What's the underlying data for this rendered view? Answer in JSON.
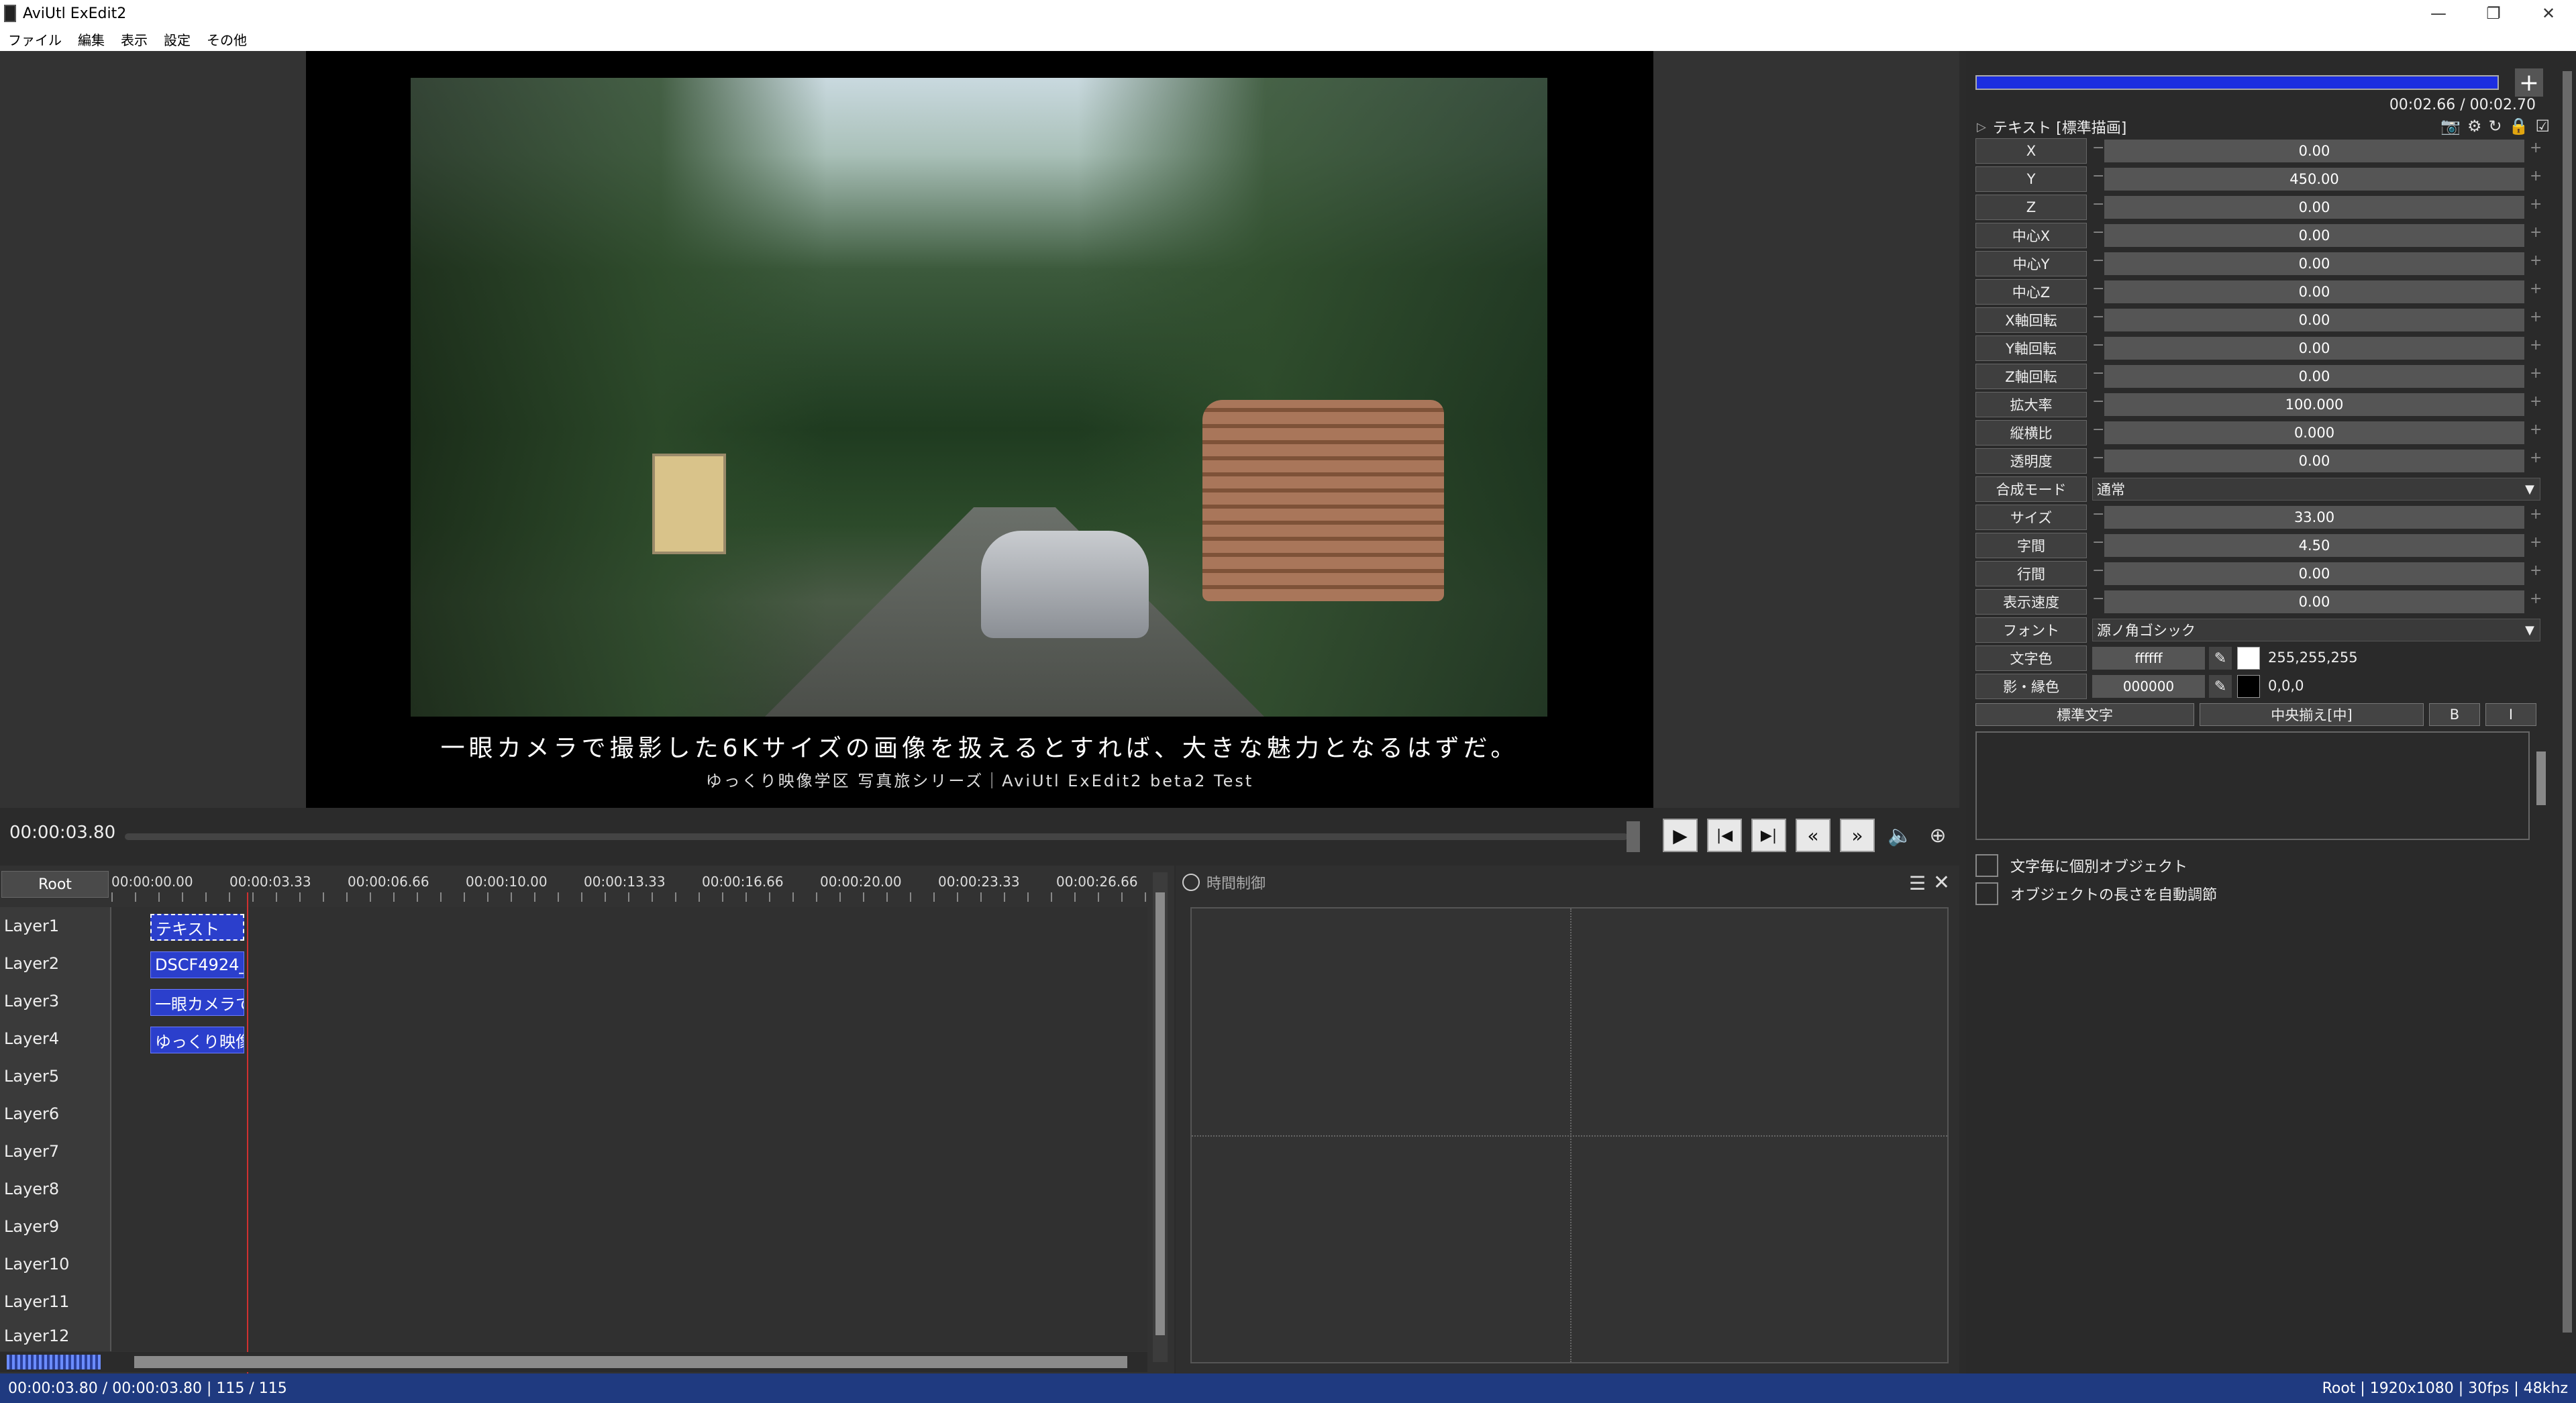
{
  "window": {
    "title": "AviUtl ExEdit2"
  },
  "menu": [
    "ファイル",
    "編集",
    "表示",
    "設定",
    "その他"
  ],
  "preview": {
    "subtitle_main": "一眼カメラで撮影した6Kサイズの画像を扱えるとすれば、大きな魅力となるはずだ。",
    "subtitle_sub": "ゆっくり映像学区 写真旅シリーズ｜AviUtl ExEdit2 beta2 Test"
  },
  "transport": {
    "timecode": "00:00:03.80"
  },
  "timeline": {
    "root_label": "Root",
    "ruler": [
      "00:00:00.00",
      "00:00:03.33",
      "00:00:06.66",
      "00:00:10.00",
      "00:00:13.33",
      "00:00:16.66",
      "00:00:20.00",
      "00:00:23.33",
      "00:00:26.66"
    ],
    "layers": [
      "Layer1",
      "Layer2",
      "Layer3",
      "Layer4",
      "Layer5",
      "Layer6",
      "Layer7",
      "Layer8",
      "Layer9",
      "Layer10",
      "Layer11",
      "Layer12"
    ],
    "clips": [
      "テキスト",
      "DSCF4924_",
      "一眼カメラで",
      "ゆっくり映像"
    ]
  },
  "time_control": {
    "title": "時間制御"
  },
  "object": {
    "time": "00:02.66 / 00:02.70",
    "name": "テキスト [標準描画]",
    "params": [
      {
        "label": "X",
        "value": "0.00"
      },
      {
        "label": "Y",
        "value": "450.00"
      },
      {
        "label": "Z",
        "value": "0.00"
      },
      {
        "label": "中心X",
        "value": "0.00"
      },
      {
        "label": "中心Y",
        "value": "0.00"
      },
      {
        "label": "中心Z",
        "value": "0.00"
      },
      {
        "label": "X軸回転",
        "value": "0.00"
      },
      {
        "label": "Y軸回転",
        "value": "0.00"
      },
      {
        "label": "Z軸回転",
        "value": "0.00"
      },
      {
        "label": "拡大率",
        "value": "100.000"
      },
      {
        "label": "縦横比",
        "value": "0.000"
      },
      {
        "label": "透明度",
        "value": "0.00"
      }
    ],
    "blend": {
      "label": "合成モード",
      "value": "通常"
    },
    "text_params": [
      {
        "label": "サイズ",
        "value": "33.00"
      },
      {
        "label": "字間",
        "value": "4.50"
      },
      {
        "label": "行間",
        "value": "0.00"
      },
      {
        "label": "表示速度",
        "value": "0.00"
      }
    ],
    "font": {
      "label": "フォント",
      "value": "源ノ角ゴシック"
    },
    "text_color": {
      "label": "文字色",
      "hex": "ffffff",
      "rgb": "255,255,255",
      "swatch": "#ffffff"
    },
    "shadow_color": {
      "label": "影・縁色",
      "hex": "000000",
      "rgb": "0,0,0",
      "swatch": "#000000"
    },
    "buttons": {
      "style": "標準文字",
      "align": "中央揃え[中]",
      "bold": "B",
      "italic": "I"
    },
    "checks": [
      "文字毎に個別オブジェクト",
      "オブジェクトの長さを自動調節"
    ]
  },
  "status": {
    "left": "00:00:03.80 / 00:00:03.80  |  115 / 115",
    "right": "Root  |  1920x1080  |  30fps  |  48khz"
  }
}
